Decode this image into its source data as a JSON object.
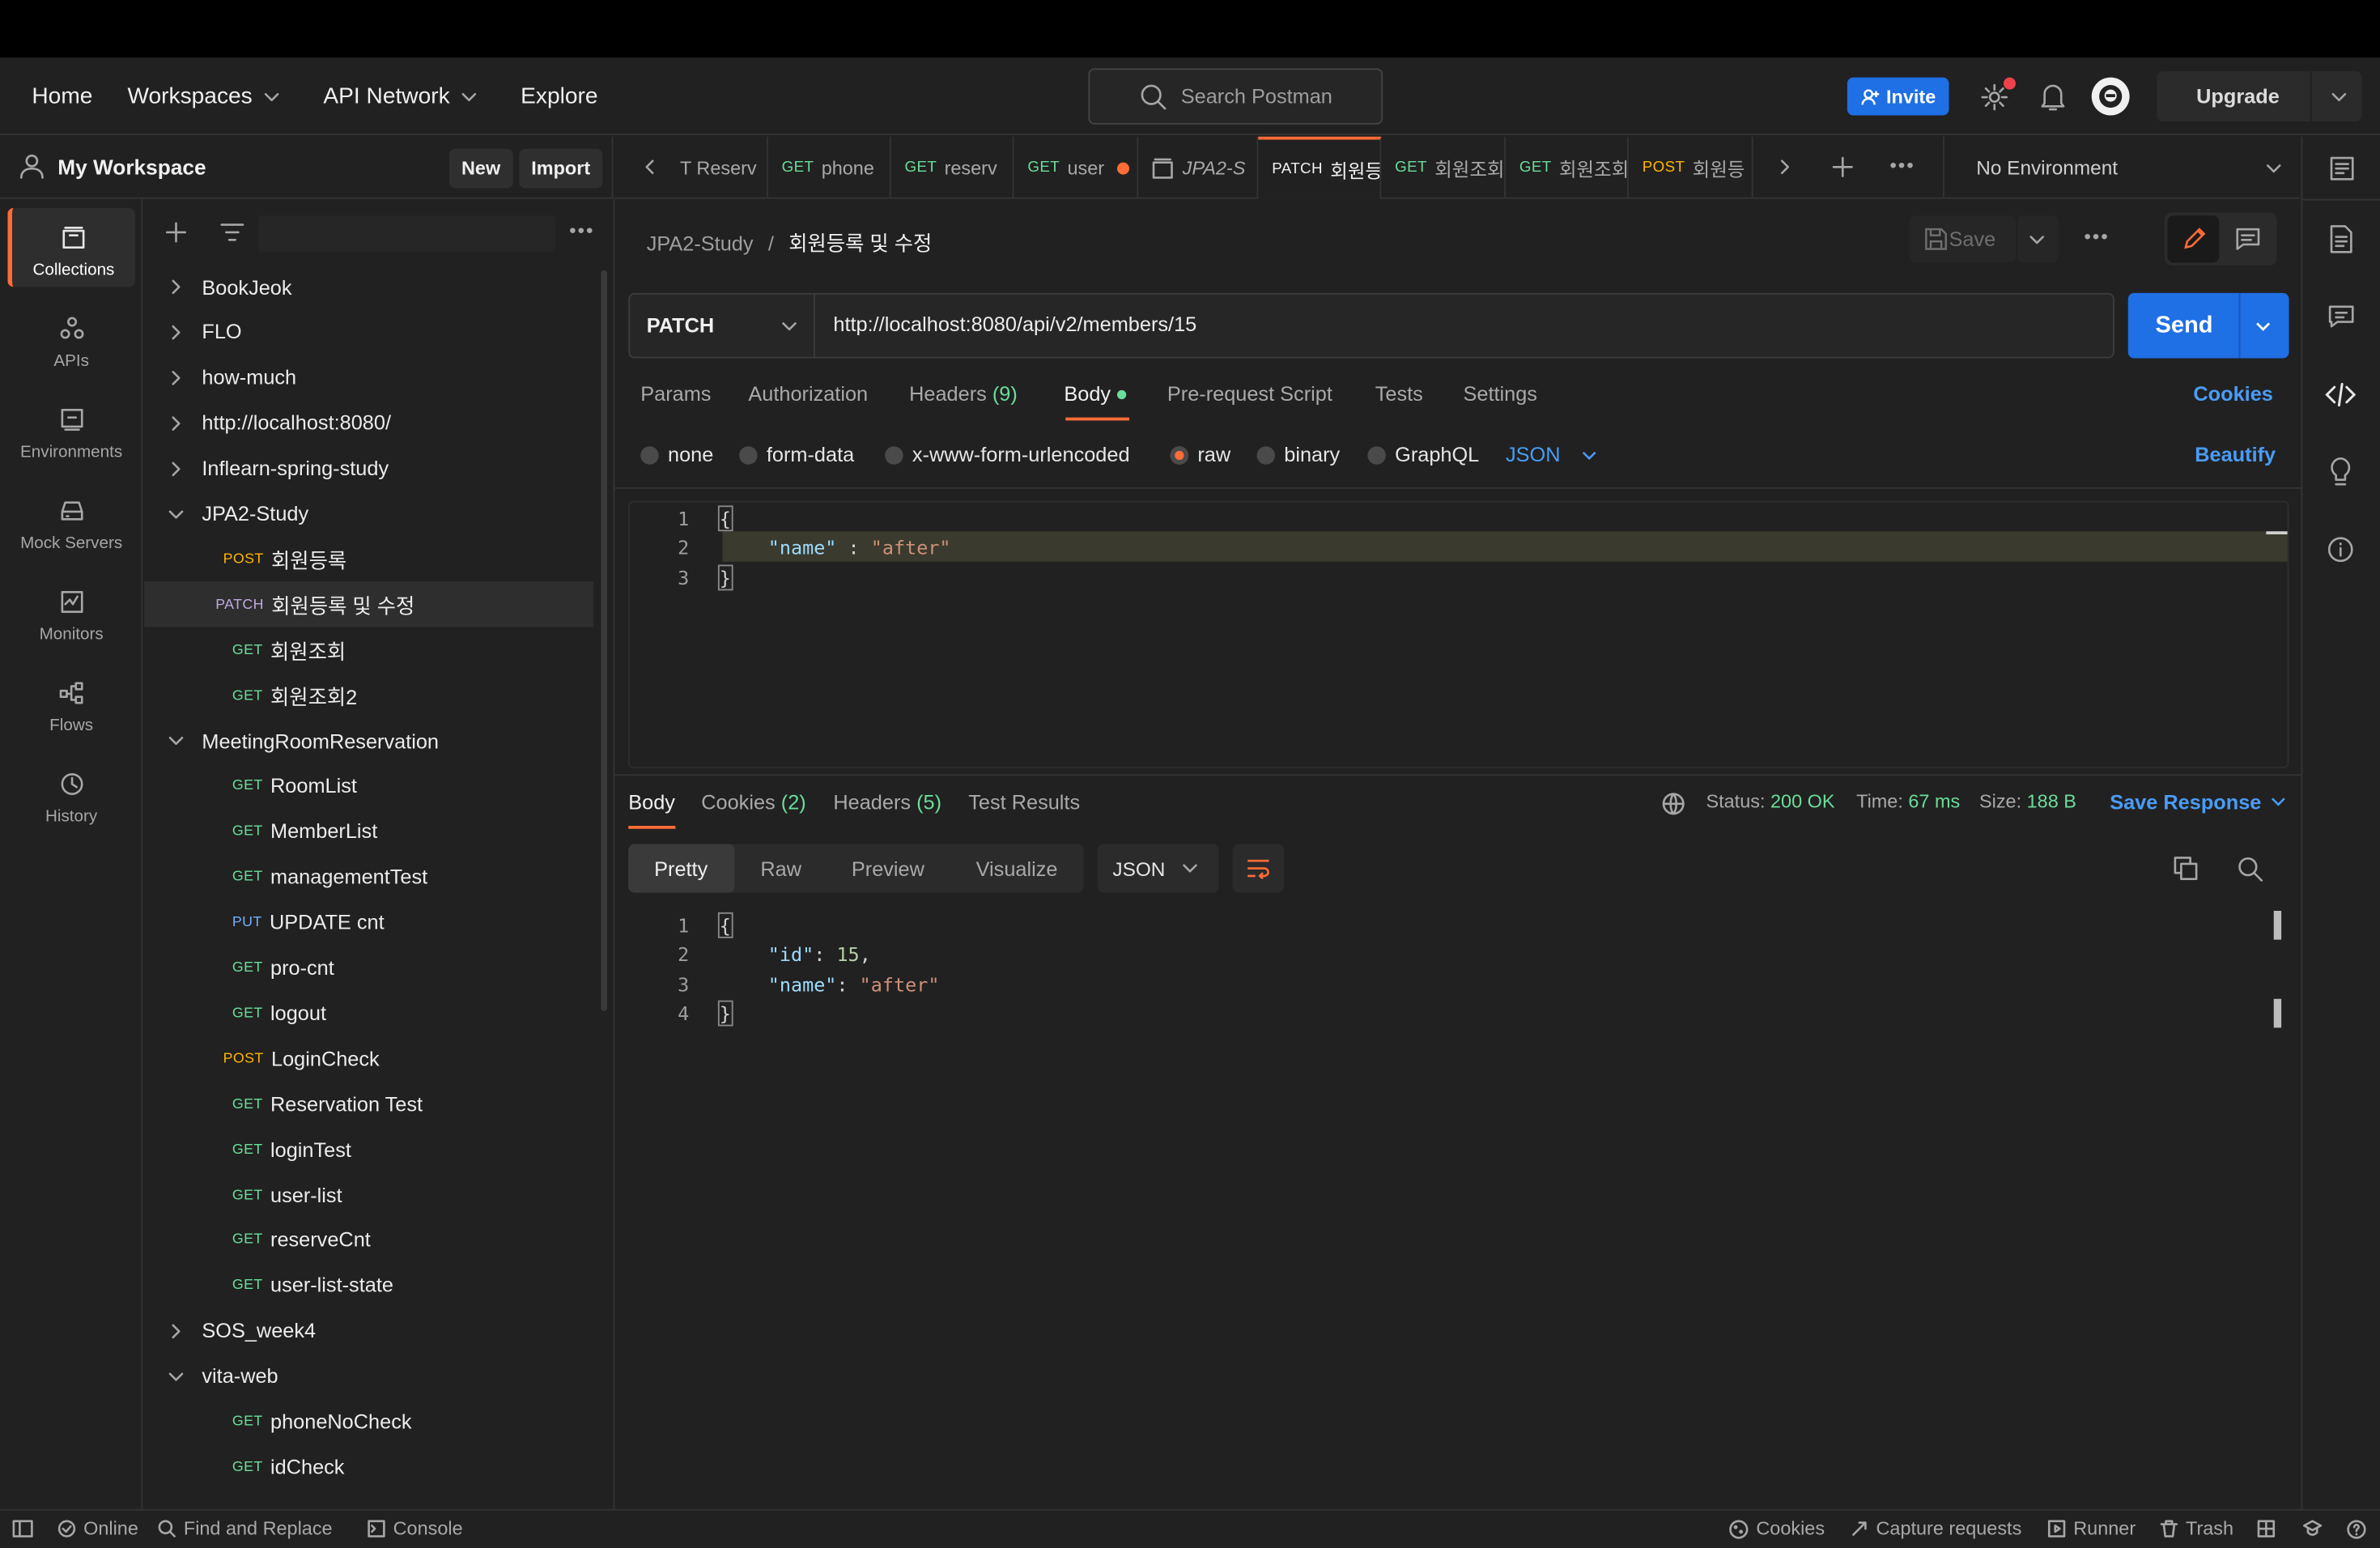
{
  "header": {
    "home": "Home",
    "workspaces": "Workspaces",
    "api_network": "API Network",
    "explore": "Explore",
    "search_placeholder": "Search Postman",
    "invite": "Invite",
    "upgrade": "Upgrade"
  },
  "workspace": {
    "title": "My Workspace",
    "new": "New",
    "import": "Import"
  },
  "rail": [
    {
      "label": "Collections",
      "icon": "collections-icon"
    },
    {
      "label": "APIs",
      "icon": "apis-icon"
    },
    {
      "label": "Environments",
      "icon": "environments-icon"
    },
    {
      "label": "Mock Servers",
      "icon": "mock-servers-icon"
    },
    {
      "label": "Monitors",
      "icon": "monitors-icon"
    },
    {
      "label": "Flows",
      "icon": "flows-icon"
    },
    {
      "label": "History",
      "icon": "history-icon"
    }
  ],
  "tree": [
    {
      "type": "folder",
      "open": false,
      "label": "BookJeok"
    },
    {
      "type": "folder",
      "open": false,
      "label": "FLO"
    },
    {
      "type": "folder",
      "open": false,
      "label": "how-much"
    },
    {
      "type": "folder",
      "open": false,
      "label": "http://localhost:8080/"
    },
    {
      "type": "folder",
      "open": false,
      "label": "Inflearn-spring-study"
    },
    {
      "type": "folder",
      "open": true,
      "label": "JPA2-Study"
    },
    {
      "type": "req",
      "method": "POST",
      "label": "회원등록"
    },
    {
      "type": "req",
      "method": "PATCH",
      "label": "회원등록 및 수정",
      "selected": true
    },
    {
      "type": "req",
      "method": "GET",
      "label": "회원조회"
    },
    {
      "type": "req",
      "method": "GET",
      "label": "회원조회2"
    },
    {
      "type": "folder",
      "open": true,
      "label": "MeetingRoomReservation"
    },
    {
      "type": "req",
      "method": "GET",
      "label": "RoomList"
    },
    {
      "type": "req",
      "method": "GET",
      "label": "MemberList"
    },
    {
      "type": "req",
      "method": "GET",
      "label": "managementTest"
    },
    {
      "type": "req",
      "method": "PUT",
      "label": "UPDATE cnt"
    },
    {
      "type": "req",
      "method": "GET",
      "label": "pro-cnt"
    },
    {
      "type": "req",
      "method": "GET",
      "label": "logout"
    },
    {
      "type": "req",
      "method": "POST",
      "label": "LoginCheck"
    },
    {
      "type": "req",
      "method": "GET",
      "label": "Reservation Test"
    },
    {
      "type": "req",
      "method": "GET",
      "label": "loginTest"
    },
    {
      "type": "req",
      "method": "GET",
      "label": "user-list"
    },
    {
      "type": "req",
      "method": "GET",
      "label": "reserveCnt"
    },
    {
      "type": "req",
      "method": "GET",
      "label": "user-list-state"
    },
    {
      "type": "folder",
      "open": false,
      "label": "SOS_week4"
    },
    {
      "type": "folder",
      "open": true,
      "label": "vita-web"
    },
    {
      "type": "req",
      "method": "GET",
      "label": "phoneNoCheck"
    },
    {
      "type": "req",
      "method": "GET",
      "label": "idCheck"
    }
  ],
  "tabs": [
    {
      "method": "",
      "label": "T Reserv"
    },
    {
      "method": "GET",
      "label": "phone"
    },
    {
      "method": "GET",
      "label": "reserv"
    },
    {
      "method": "GET",
      "label": "user",
      "dot": true
    },
    {
      "method": "",
      "label": "JPA2-S",
      "italic": true
    },
    {
      "method": "PATCH",
      "label": "회원등",
      "active": true
    },
    {
      "method": "GET",
      "label": "회원조회"
    },
    {
      "method": "GET",
      "label": "회원조회"
    },
    {
      "method": "POST",
      "label": "회원등"
    }
  ],
  "environment": "No Environment",
  "breadcrumb": {
    "collection": "JPA2-Study",
    "separator": "/",
    "request": "회원등록 및 수정"
  },
  "save": "Save",
  "request": {
    "method": "PATCH",
    "url": "http://localhost:8080/api/v2/members/15",
    "send": "Send"
  },
  "request_tabs": {
    "params": "Params",
    "authorization": "Authorization",
    "headers": "Headers",
    "headers_count": "(9)",
    "body": "Body",
    "prerequest": "Pre-request Script",
    "tests": "Tests",
    "settings": "Settings",
    "cookies": "Cookies"
  },
  "body_types": {
    "none": "none",
    "form_data": "form-data",
    "urlencoded": "x-www-form-urlencoded",
    "raw": "raw",
    "binary": "binary",
    "graphql": "GraphQL",
    "format": "JSON",
    "beautify": "Beautify"
  },
  "request_body": {
    "line1": "{",
    "key": "\"name\"",
    "sep": " : ",
    "value": "\"after\"",
    "line3": "}"
  },
  "response": {
    "body": "Body",
    "cookies": "Cookies",
    "cookies_count": "(2)",
    "headers": "Headers",
    "headers_count": "(5)",
    "test_results": "Test Results",
    "status_label": "Status:",
    "status": "200 OK",
    "time_label": "Time:",
    "time": "67 ms",
    "size_label": "Size:",
    "size": "188 B",
    "save_response": "Save Response",
    "pretty": "Pretty",
    "raw": "Raw",
    "preview": "Preview",
    "visualize": "Visualize",
    "format": "JSON"
  },
  "response_body": {
    "open": "{",
    "id_key": "\"id\"",
    "id_value": "15",
    "name_key": "\"name\"",
    "name_value": "\"after\"",
    "close": "}"
  },
  "statusbar": {
    "online": "Online",
    "find_replace": "Find and Replace",
    "console": "Console",
    "cookies": "Cookies",
    "capture": "Capture requests",
    "runner": "Runner",
    "trash": "Trash"
  },
  "colors": {
    "accent": "#ff6c37",
    "primary": "#1f6fe5",
    "get": "#6bdd9a",
    "post": "#ffb400",
    "patch": "#c0a8e1",
    "put": "#74aef6"
  }
}
